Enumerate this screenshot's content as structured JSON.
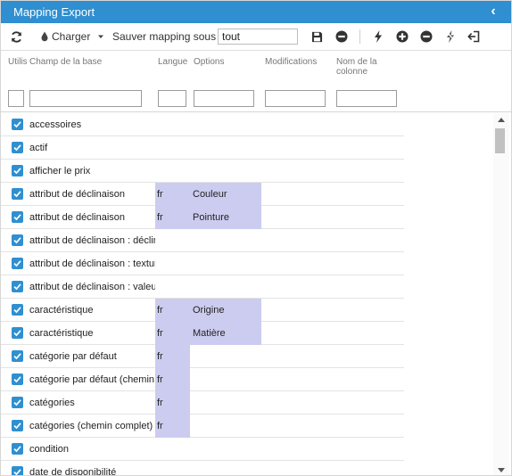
{
  "window": {
    "title": "Mapping Export"
  },
  "toolbar": {
    "load_label": "Charger",
    "save_as_label": "Sauver mapping sous",
    "mapping_name_value": "tout"
  },
  "columns": {
    "use": "Utilisé",
    "field": "Champ de la base",
    "language": "Langue",
    "options": "Options",
    "modifications": "Modifications",
    "column_name": "Nom de la colonne"
  },
  "rows": [
    {
      "field": "accessoires",
      "lang": "",
      "option": "",
      "checked": true
    },
    {
      "field": "actif",
      "lang": "",
      "option": "",
      "checked": true
    },
    {
      "field": "afficher le prix",
      "lang": "",
      "option": "",
      "checked": true
    },
    {
      "field": "attribut de déclinaison",
      "lang": "fr",
      "option": "Couleur",
      "checked": true
    },
    {
      "field": "attribut de déclinaison",
      "lang": "fr",
      "option": "Pointure",
      "checked": true
    },
    {
      "field": "attribut de déclinaison : déclinaison",
      "lang": "",
      "option": "",
      "checked": true
    },
    {
      "field": "attribut de déclinaison : texture",
      "lang": "",
      "option": "",
      "checked": true
    },
    {
      "field": "attribut de déclinaison : valeur",
      "lang": "",
      "option": "",
      "checked": true
    },
    {
      "field": "caractéristique",
      "lang": "fr",
      "option": "Origine",
      "checked": true
    },
    {
      "field": "caractéristique",
      "lang": "fr",
      "option": "Matière",
      "checked": true
    },
    {
      "field": "catégorie par défaut",
      "lang": "fr",
      "option": "",
      "checked": true
    },
    {
      "field": "catégorie par défaut (chemin complet)",
      "lang": "fr",
      "option": "",
      "checked": true
    },
    {
      "field": "catégories",
      "lang": "fr",
      "option": "",
      "checked": true
    },
    {
      "field": "catégories (chemin complet)",
      "lang": "fr",
      "option": "",
      "checked": true
    },
    {
      "field": "condition",
      "lang": "",
      "option": "",
      "checked": true
    },
    {
      "field": "date de disponibilité",
      "lang": "",
      "option": "",
      "checked": true
    }
  ],
  "colors": {
    "title_bar": "#2f8fd0",
    "checkbox": "#2f8fd0",
    "highlight_cell": "#ccccf0"
  },
  "icons": {
    "collapse": "chevron-left-icon",
    "refresh": "refresh-icon",
    "load": "drop-icon",
    "dropdown": "caret-down-icon",
    "save": "floppy-disk-icon",
    "remove": "minus-circle-icon",
    "flash": "bolt-icon",
    "add": "plus-circle-icon",
    "flash_off": "bolt-off-icon",
    "exit": "sign-in-icon"
  }
}
